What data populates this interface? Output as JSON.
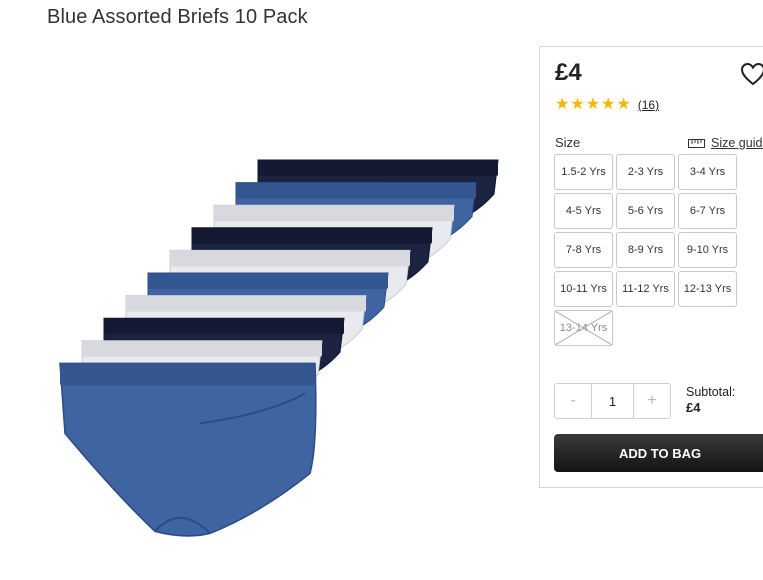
{
  "product": {
    "title": "Blue Assorted Briefs 10 Pack"
  },
  "pricing": {
    "price": "£4"
  },
  "rating": {
    "stars": 5,
    "count_label": "(16)"
  },
  "size": {
    "label": "Size",
    "guide_label": "Size guide",
    "options": [
      {
        "label": "1.5-2 Yrs",
        "available": true
      },
      {
        "label": "2-3 Yrs",
        "available": true
      },
      {
        "label": "3-4 Yrs",
        "available": true
      },
      {
        "label": "4-5 Yrs",
        "available": true
      },
      {
        "label": "5-6 Yrs",
        "available": true
      },
      {
        "label": "6-7 Yrs",
        "available": true
      },
      {
        "label": "7-8 Yrs",
        "available": true
      },
      {
        "label": "8-9 Yrs",
        "available": true
      },
      {
        "label": "9-10 Yrs",
        "available": true
      },
      {
        "label": "10-11 Yrs",
        "available": true
      },
      {
        "label": "11-12 Yrs",
        "available": true
      },
      {
        "label": "12-13 Yrs",
        "available": true
      },
      {
        "label": "13-14 Yrs",
        "available": false
      }
    ]
  },
  "quantity": {
    "minus": "-",
    "value": "1",
    "plus": "+"
  },
  "subtotal": {
    "label": "Subtotal:",
    "amount": "£4"
  },
  "cart": {
    "add_label": "ADD TO BAG"
  },
  "icons": {
    "wishlist": "heart-outline-icon",
    "size_guide": "ruler-icon",
    "rating": "star-icon"
  },
  "colors": {
    "navy": "#1a2240",
    "blue": "#3e64a3",
    "white_grey": "#e8e9ec",
    "star": "#f5b800",
    "button_dark": "#1f1f1f"
  },
  "image": {
    "alt": "Blue Assorted Briefs 10 Pack",
    "briefs": [
      "navy",
      "blue",
      "white",
      "navy",
      "white",
      "blue",
      "white",
      "navy",
      "white",
      "blue"
    ]
  }
}
